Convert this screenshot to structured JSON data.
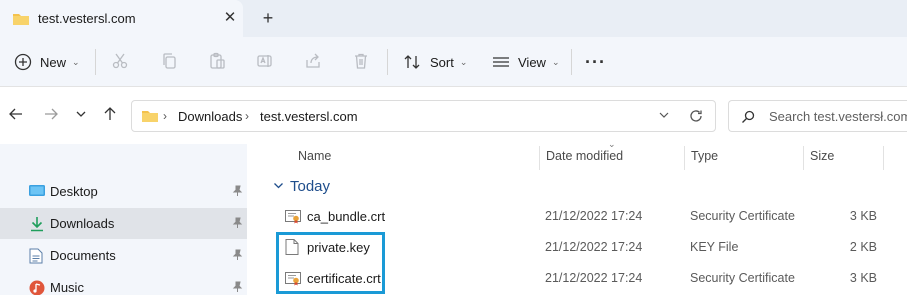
{
  "tab": {
    "title": "test.vestersl.com",
    "close_glyph": "✕",
    "new_tab_glyph": "+"
  },
  "toolbar": {
    "new_label": "New",
    "sort_label": "Sort",
    "view_label": "View",
    "more_label": "···",
    "icons": [
      "cut-icon",
      "copy-icon",
      "paste-icon",
      "rename-icon",
      "share-icon",
      "delete-icon"
    ]
  },
  "address": {
    "crumbs": [
      "Downloads",
      "test.vestersl.com"
    ],
    "separator": "›"
  },
  "search": {
    "placeholder": "Search test.vestersł.com"
  },
  "sidebar": {
    "items": [
      {
        "label": "Desktop",
        "icon": "desktop-icon",
        "pinned": true
      },
      {
        "label": "Downloads",
        "icon": "download-icon",
        "pinned": true,
        "selected": true
      },
      {
        "label": "Documents",
        "icon": "document-icon",
        "pinned": true
      },
      {
        "label": "Music",
        "icon": "music-icon",
        "pinned": true
      }
    ]
  },
  "columns": {
    "name": "Name",
    "date": "Date modified",
    "type": "Type",
    "size": "Size"
  },
  "group": {
    "label": "Today"
  },
  "files": [
    {
      "name": "ca_bundle.crt",
      "date": "21/12/2022 17:24",
      "type": "Security Certificate",
      "size": "3 KB",
      "icon": "certificate-icon"
    },
    {
      "name": "private.key",
      "date": "21/12/2022 17:24",
      "type": "KEY File",
      "size": "2 KB",
      "icon": "file-icon"
    },
    {
      "name": "certificate.crt",
      "date": "21/12/2022 17:24",
      "type": "Security Certificate",
      "size": "3 KB",
      "icon": "certificate-icon"
    }
  ],
  "colors": {
    "accent": "#1a9ad6",
    "folder": "#f4c24d",
    "group_text": "#1f4e8c"
  }
}
